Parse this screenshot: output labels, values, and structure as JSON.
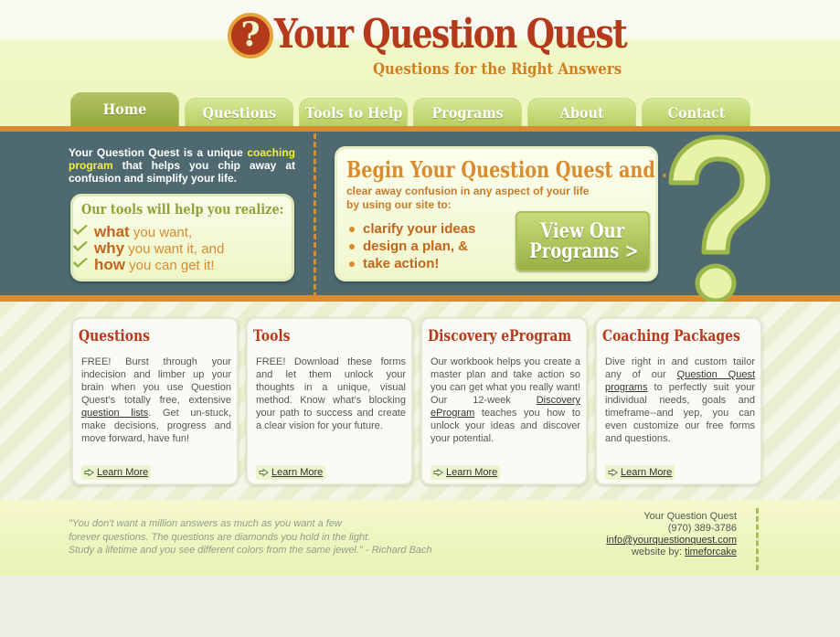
{
  "brand": {
    "logo_glyph": "?",
    "title": "Your Question Quest",
    "tagline": "Questions for the Right Answers"
  },
  "nav": {
    "tabs": [
      {
        "label": "Home",
        "active": true
      },
      {
        "label": "Questions",
        "active": false
      },
      {
        "label": "Tools to Help",
        "active": false
      },
      {
        "label": "Programs",
        "active": false
      },
      {
        "label": "About",
        "active": false
      },
      {
        "label": "Contact",
        "active": false
      }
    ]
  },
  "intro": {
    "part1": "Your Question Quest is a unique ",
    "highlight": "coaching program",
    "part2": " that helps you chip away at confusion and simplify your life."
  },
  "tools": {
    "heading": "Our tools will help you realize:",
    "items": [
      {
        "bold": "what",
        "rest": " you want,"
      },
      {
        "bold": "why",
        "rest": " you want it, and"
      },
      {
        "bold": "how",
        "rest": " you can get it!"
      }
    ]
  },
  "quest": {
    "title": "Begin Your Question Quest and ...",
    "subtitle": "clear away confusion in any aspect of your life by using our site to:",
    "bullets": [
      "clarify your ideas",
      "design a plan, &",
      "take action!"
    ],
    "button_line1": "View Our",
    "button_line2": "Programs >"
  },
  "cards": [
    {
      "title": "Questions",
      "body_before": "FREE! Burst through your indecision and limber up your brain when you use Question Quest’s totally free, extensive ",
      "link": "question lists",
      "body_after": ". Get un-stuck, make decisions, progress and move forward, have fun!",
      "learn_more": "Learn More"
    },
    {
      "title": "Tools",
      "body_before": "FREE! Download these forms and let them unlock your thoughts in a unique, visual method. Know what’s blocking your path to success and create a clear vision for your future.",
      "link": "",
      "body_after": "",
      "learn_more": "Learn More"
    },
    {
      "title": "Discovery eProgram",
      "body_before": "Our workbook helps you create a master plan and take action so you can get what you really want! Our 12-week ",
      "link": "Discovery eProgram",
      "body_after": " teaches you how to unlock your ideas and discover your potential.",
      "learn_more": "Learn More"
    },
    {
      "title": "Coaching Packages",
      "body_before": "Dive right in and custom tailor any of our ",
      "link": "Question Quest programs",
      "body_after": " to perfectly suit your individual needs, goals and timeframe--and yep, you can even customize our free forms and questions.",
      "learn_more": "Learn More"
    }
  ],
  "footer": {
    "quote_lines": [
      "\"You don't want a million answers as much as you want a few",
      "forever questions. The questions are diamonds you hold in the light.",
      "Study a lifetime and you see different colors from the same jewel.\" - Richard Bach"
    ],
    "company": "Your Question Quest",
    "phone": "(970) 389-3786",
    "email": "info@yourquestionquest.com",
    "website_label": "website by: ",
    "website_link": "timeforcake"
  },
  "colors": {
    "brand_red": "#b53a1c",
    "orange": "#d98b2f",
    "slate": "#4e6a70",
    "green": "#a8bd5c"
  }
}
